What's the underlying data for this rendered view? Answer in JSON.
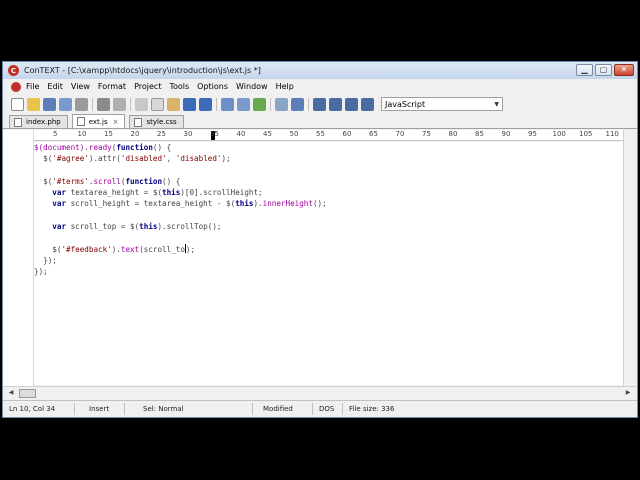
{
  "window": {
    "title": "ConTEXT - [C:\\xampp\\htdocs\\jquery\\introduction\\js\\ext.js *]",
    "app_icon_letter": "C",
    "minimize": "▁",
    "maximize": "▢",
    "close": "✕"
  },
  "menu": [
    "File",
    "Edit",
    "View",
    "Format",
    "Project",
    "Tools",
    "Options",
    "Window",
    "Help"
  ],
  "toolbar": {
    "language": "JavaScript"
  },
  "tabs": [
    {
      "label": "index.php",
      "active": false
    },
    {
      "label": "ext.js",
      "active": true,
      "close": "×"
    },
    {
      "label": "style.css",
      "active": false
    }
  ],
  "ruler": [
    "5",
    "10",
    "15",
    "20",
    "25",
    "30",
    "35",
    "40",
    "45",
    "50",
    "55",
    "60",
    "65",
    "70",
    "75",
    "80",
    "85",
    "90",
    "95",
    "100",
    "105",
    "110"
  ],
  "code": [
    [
      [
        "o",
        "$(document)"
      ],
      [
        "p",
        "."
      ],
      [
        "o",
        "ready"
      ],
      [
        "p",
        "("
      ],
      [
        "k",
        "function"
      ],
      [
        "p",
        "() {"
      ]
    ],
    [
      [
        "p",
        "  $("
      ],
      [
        "s",
        "'#agree'"
      ],
      [
        "p",
        ").attr("
      ],
      [
        "s",
        "'disabled'"
      ],
      [
        "p",
        ", "
      ],
      [
        "s",
        "'disabled'"
      ],
      [
        "p",
        ");"
      ]
    ],
    [],
    [
      [
        "p",
        "  $("
      ],
      [
        "s",
        "'#terms'"
      ],
      [
        "p",
        "."
      ],
      [
        "o",
        "scroll"
      ],
      [
        "p",
        "("
      ],
      [
        "k",
        "function"
      ],
      [
        "p",
        "() {"
      ]
    ],
    [
      [
        "p",
        "    "
      ],
      [
        "k",
        "var"
      ],
      [
        "p",
        " textarea_height = $("
      ],
      [
        "k",
        "this"
      ],
      [
        "p",
        ")[0].scrollHeight;"
      ]
    ],
    [
      [
        "p",
        "    "
      ],
      [
        "k",
        "var"
      ],
      [
        "p",
        " scroll_height = textarea_height - $("
      ],
      [
        "k",
        "this"
      ],
      [
        "p",
        ")."
      ],
      [
        "o",
        "innerHeight"
      ],
      [
        "p",
        "();"
      ]
    ],
    [],
    [
      [
        "p",
        "    "
      ],
      [
        "k",
        "var"
      ],
      [
        "p",
        " scroll_top = $("
      ],
      [
        "k",
        "this"
      ],
      [
        "p",
        ").scrollTop();"
      ]
    ],
    [],
    [
      [
        "p",
        "    $("
      ],
      [
        "s",
        "'#feedback'"
      ],
      [
        "p",
        ")."
      ],
      [
        "o",
        "text"
      ],
      [
        "p",
        "(scroll_to"
      ],
      [
        "caret",
        ""
      ],
      [
        "p",
        ");"
      ]
    ],
    [
      [
        "p",
        "  });"
      ]
    ],
    [
      [
        "p",
        "});"
      ]
    ]
  ],
  "status": {
    "position": "Ln 10, Col 34",
    "mode": "Insert",
    "selection": "Sel: Normal",
    "modified": "Modified",
    "line_endings": "DOS",
    "file_size": "File size: 336"
  }
}
